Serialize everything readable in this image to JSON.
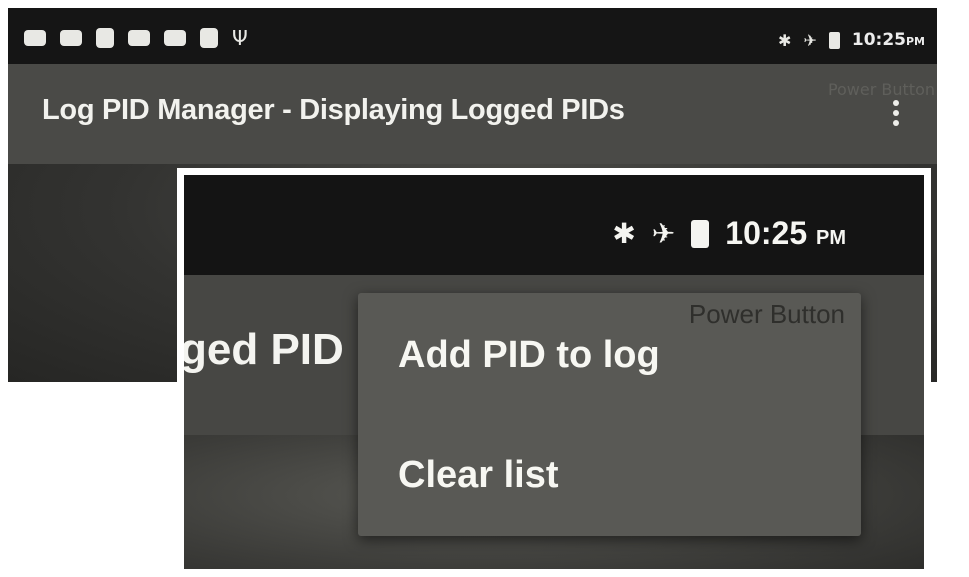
{
  "status_bar": {
    "time": "10:25",
    "ampm": "PM",
    "system_icons": [
      "bluetooth-icon",
      "airplane-mode-icon",
      "battery-icon"
    ],
    "notification_icons": [
      "notification-icon",
      "notification-icon",
      "notification-icon",
      "notification-icon",
      "notification-icon",
      "notification-icon",
      "usb-icon"
    ]
  },
  "app_bar": {
    "title": "Log PID Manager - Displaying Logged PIDs",
    "overflow_icon": "more-vert-icon"
  },
  "background_labels": {
    "power_button": "Power Button"
  },
  "inset": {
    "title_fragment": "ged PID",
    "menu": {
      "items": [
        {
          "label": "Add PID to log"
        },
        {
          "label": "Clear list"
        }
      ]
    }
  },
  "colors": {
    "status_bar": "#151515",
    "app_bar": "#4a4a47",
    "menu_background": "#595955",
    "text": "#f2f2ee",
    "inset_border": "#ffffff"
  }
}
